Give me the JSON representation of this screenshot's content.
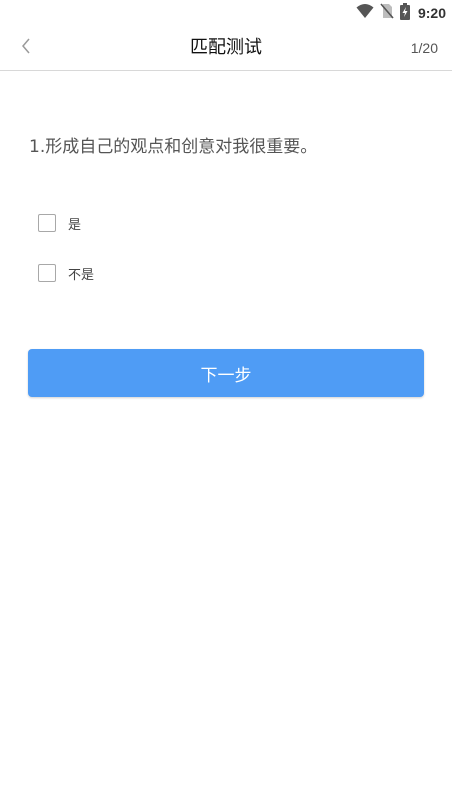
{
  "status_bar": {
    "time": "9:20",
    "icons": [
      "wifi-icon",
      "no-sim-icon",
      "battery-charging-icon"
    ]
  },
  "nav": {
    "back_icon": "chevron-left-icon",
    "title": "匹配测试",
    "progress": "1/20"
  },
  "question": {
    "text": "1.形成自己的观点和创意对我很重要。"
  },
  "options": [
    {
      "label": "是",
      "checked": false
    },
    {
      "label": "不是",
      "checked": false
    }
  ],
  "actions": {
    "next_label": "下一步"
  },
  "colors": {
    "primary_button": "#4f9cf5",
    "divider": "#d8d8d8",
    "question_text": "#555555"
  }
}
